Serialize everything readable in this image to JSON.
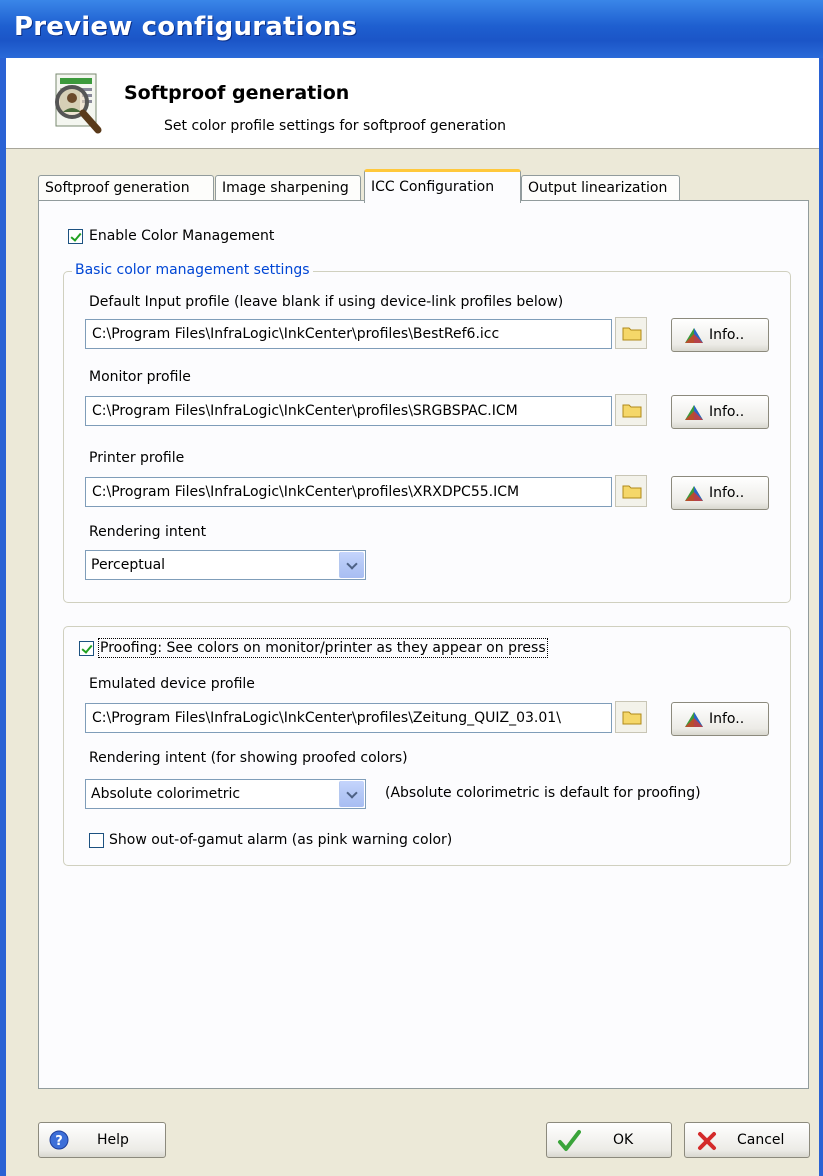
{
  "window": {
    "title": "Preview configurations"
  },
  "header": {
    "title": "Softproof generation",
    "subtitle": "Set color profile settings for softproof generation",
    "icon": "magnifier-document-icon"
  },
  "tabs": [
    {
      "label": "Softproof generation",
      "active": false
    },
    {
      "label": "Image sharpening",
      "active": false
    },
    {
      "label": "ICC Configuration",
      "active": true
    },
    {
      "label": "Output linearization",
      "active": false
    }
  ],
  "enable_cm": {
    "label": "Enable Color Management",
    "checked": true
  },
  "basic": {
    "legend": "Basic color management settings",
    "input_profile": {
      "label": "Default Input profile (leave blank if using device-link profiles below)",
      "value": "C:\\Program Files\\InfraLogic\\InkCenter\\profiles\\BestRef6.icc"
    },
    "monitor_profile": {
      "label": "Monitor profile",
      "value": "C:\\Program Files\\InfraLogic\\InkCenter\\profiles\\SRGBSPAC.ICM"
    },
    "printer_profile": {
      "label": "Printer profile",
      "value": "C:\\Program Files\\InfraLogic\\InkCenter\\profiles\\XRXDPC55.ICM"
    },
    "rendering_intent": {
      "label": "Rendering intent",
      "value": "Perceptual"
    }
  },
  "proofing": {
    "checkbox_label": "Proofing: See colors on monitor/printer as they appear on press",
    "checked": true,
    "emulated": {
      "label": "Emulated device profile",
      "value": "C:\\Program Files\\InfraLogic\\InkCenter\\profiles\\Zeitung_QUIZ_03.01\\"
    },
    "rendering_intent": {
      "label": "Rendering intent (for showing proofed colors)",
      "value": "Absolute colorimetric",
      "note": "(Absolute colorimetric is default for proofing)"
    },
    "gamut_alarm": {
      "label": "Show out-of-gamut alarm (as pink warning color)",
      "checked": false
    }
  },
  "buttons": {
    "info": "Info..",
    "help": "Help",
    "ok": "OK",
    "cancel": "Cancel"
  },
  "colors": {
    "titlebar": "#1e5fd0",
    "accent_link": "#0046d5",
    "check": "#21a121"
  }
}
